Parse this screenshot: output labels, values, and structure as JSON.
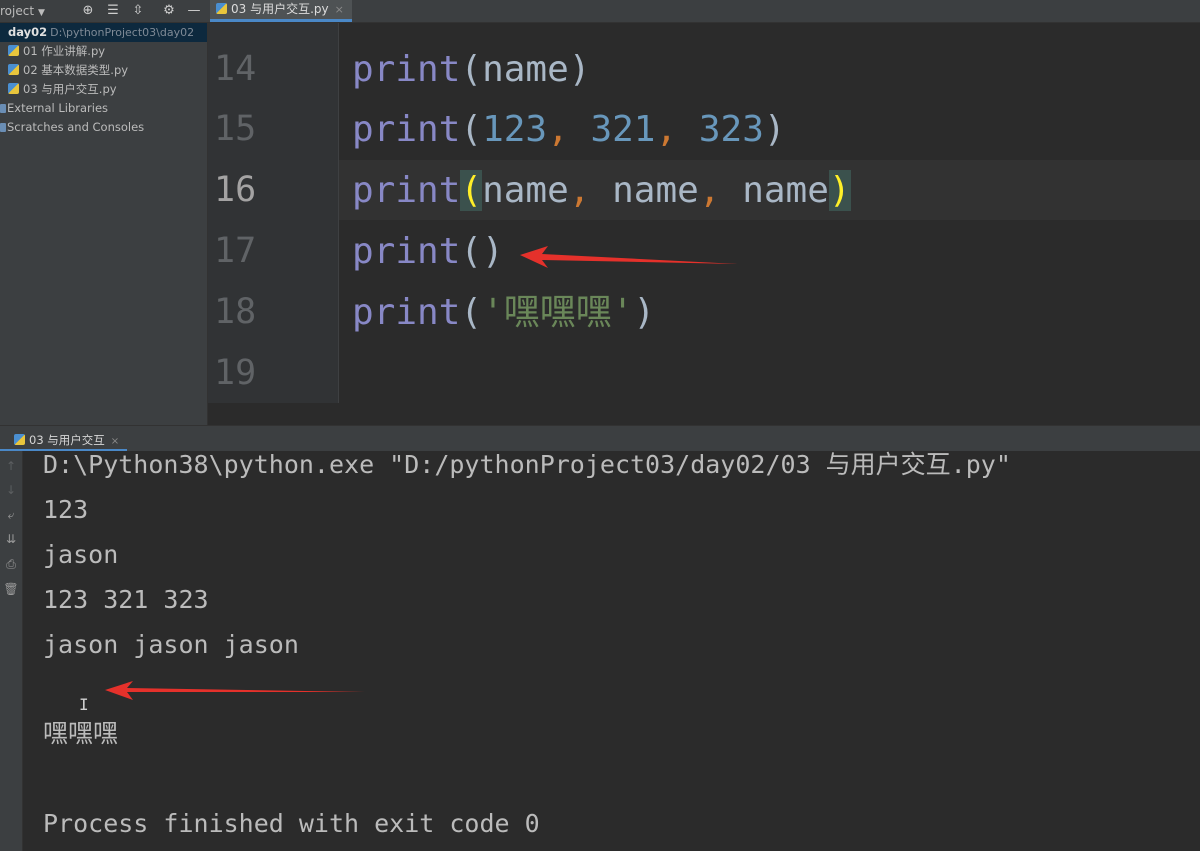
{
  "topbar": {
    "project_switch": "roject",
    "tab_file": "03 与用户交互.py"
  },
  "sidebar": {
    "root_name": "day02",
    "root_path": "D:\\pythonProject03\\day02",
    "files": [
      "01 作业讲解.py",
      "02 基本数据类型.py",
      "03 与用户交互.py"
    ],
    "external_libraries": "External Libraries",
    "scratches": "Scratches and Consoles"
  },
  "editor": {
    "line_numbers": [
      "14",
      "15",
      "16",
      "17",
      "18",
      "19"
    ],
    "current_line": "16",
    "lines": {
      "l14": {
        "fn": "print",
        "arg": "name"
      },
      "l15": {
        "fn": "print",
        "a1": "123",
        "a2": "321",
        "a3": "323"
      },
      "l16": {
        "fn": "print",
        "a1": "name",
        "a2": "name",
        "a3": "name"
      },
      "l17": {
        "fn": "print"
      },
      "l18": {
        "fn": "print",
        "str": "'嘿嘿嘿'"
      }
    }
  },
  "run": {
    "tab_label": "03 与用户交互",
    "output": [
      "D:\\Python38\\python.exe \"D:/pythonProject03/day02/03 与用户交互.py\"",
      "123",
      "jason",
      "123 321 323",
      "jason jason jason",
      "",
      "嘿嘿嘿",
      "",
      "Process finished with exit code 0"
    ]
  },
  "colors": {
    "annotation_arrow": "#e5312b",
    "keyword_print": "#8888c6",
    "number": "#6897bb",
    "string": "#6a8759",
    "comma": "#cc7832",
    "paren_match": "#ffef28"
  },
  "icons": {
    "toolbar": [
      "crosshair-icon",
      "expand-all-icon",
      "collapse-all-icon",
      "gear-icon",
      "minimize-icon"
    ],
    "run_toolbar": [
      "up-arrow-icon",
      "down-arrow-icon",
      "soft-wrap-icon",
      "scroll-to-end-icon",
      "print-icon",
      "trash-icon"
    ]
  }
}
